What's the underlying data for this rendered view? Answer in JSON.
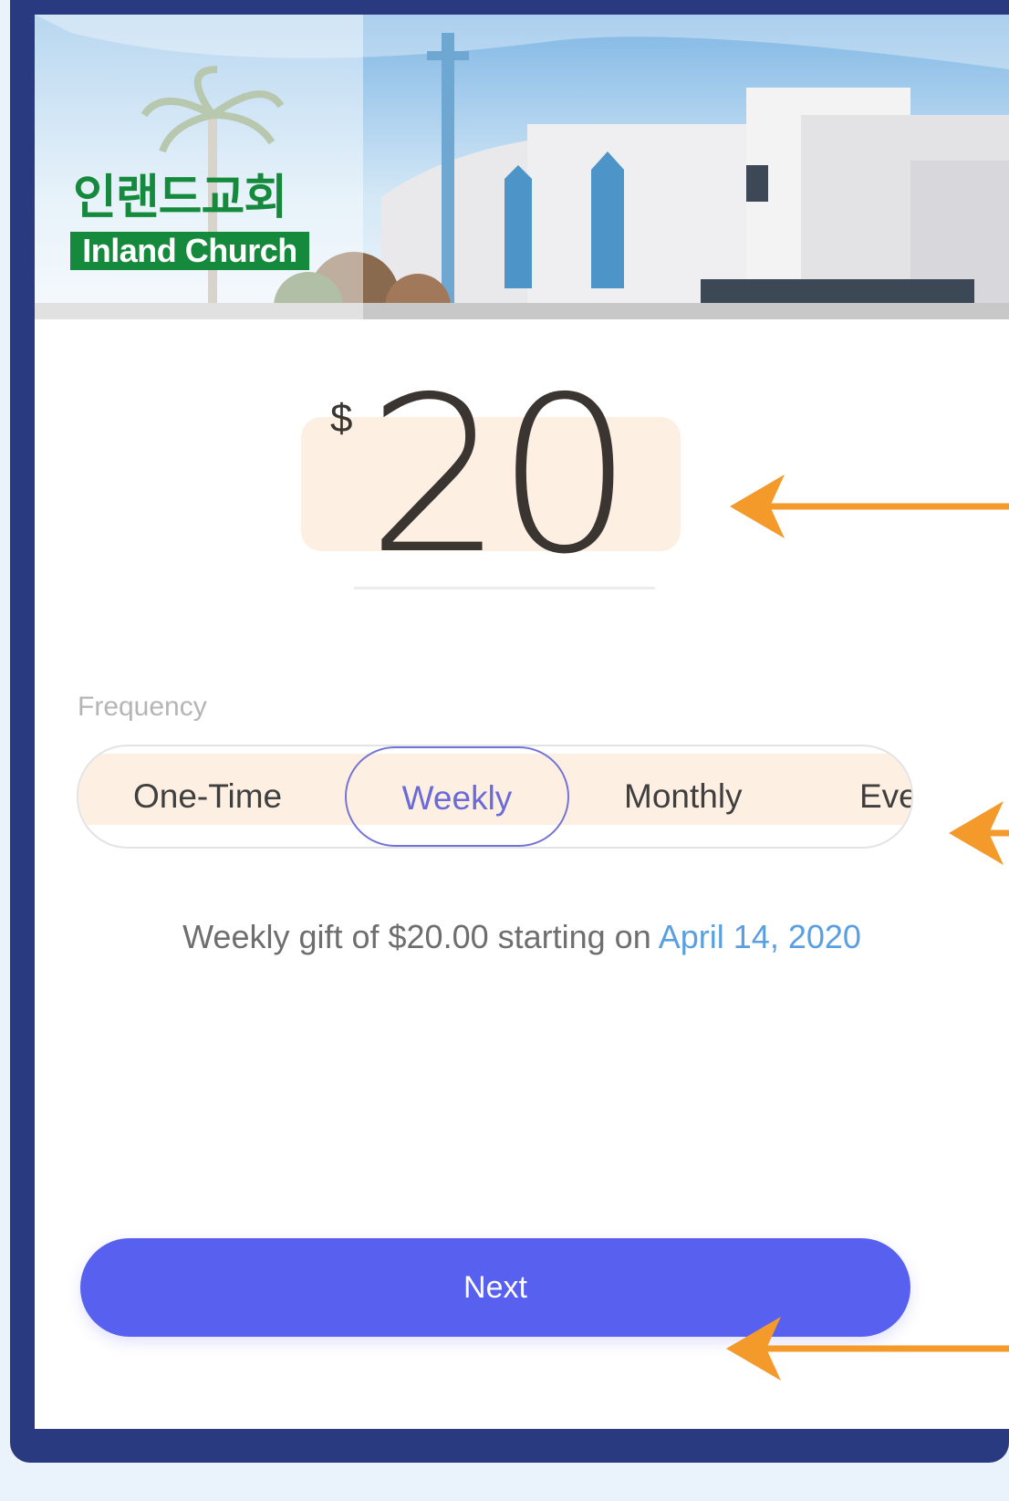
{
  "brand": {
    "name_korean": "인랜드교회",
    "name_english": "Inland Church"
  },
  "amount": {
    "currency_symbol": "$",
    "value": "20"
  },
  "frequency": {
    "label": "Frequency",
    "options": [
      "One-Time",
      "Weekly",
      "Monthly",
      "Eve"
    ],
    "selected": "Weekly"
  },
  "summary": {
    "text": "Weekly gift of $20.00 starting on ",
    "date": "April 14, 2020"
  },
  "actions": {
    "next_label": "Next"
  },
  "colors": {
    "frame": "#2a3a80",
    "highlight": "#fdf0e2",
    "accent": "#5860f0",
    "annotation_arrow": "#f39a2b",
    "logo_green": "#168a3c"
  }
}
